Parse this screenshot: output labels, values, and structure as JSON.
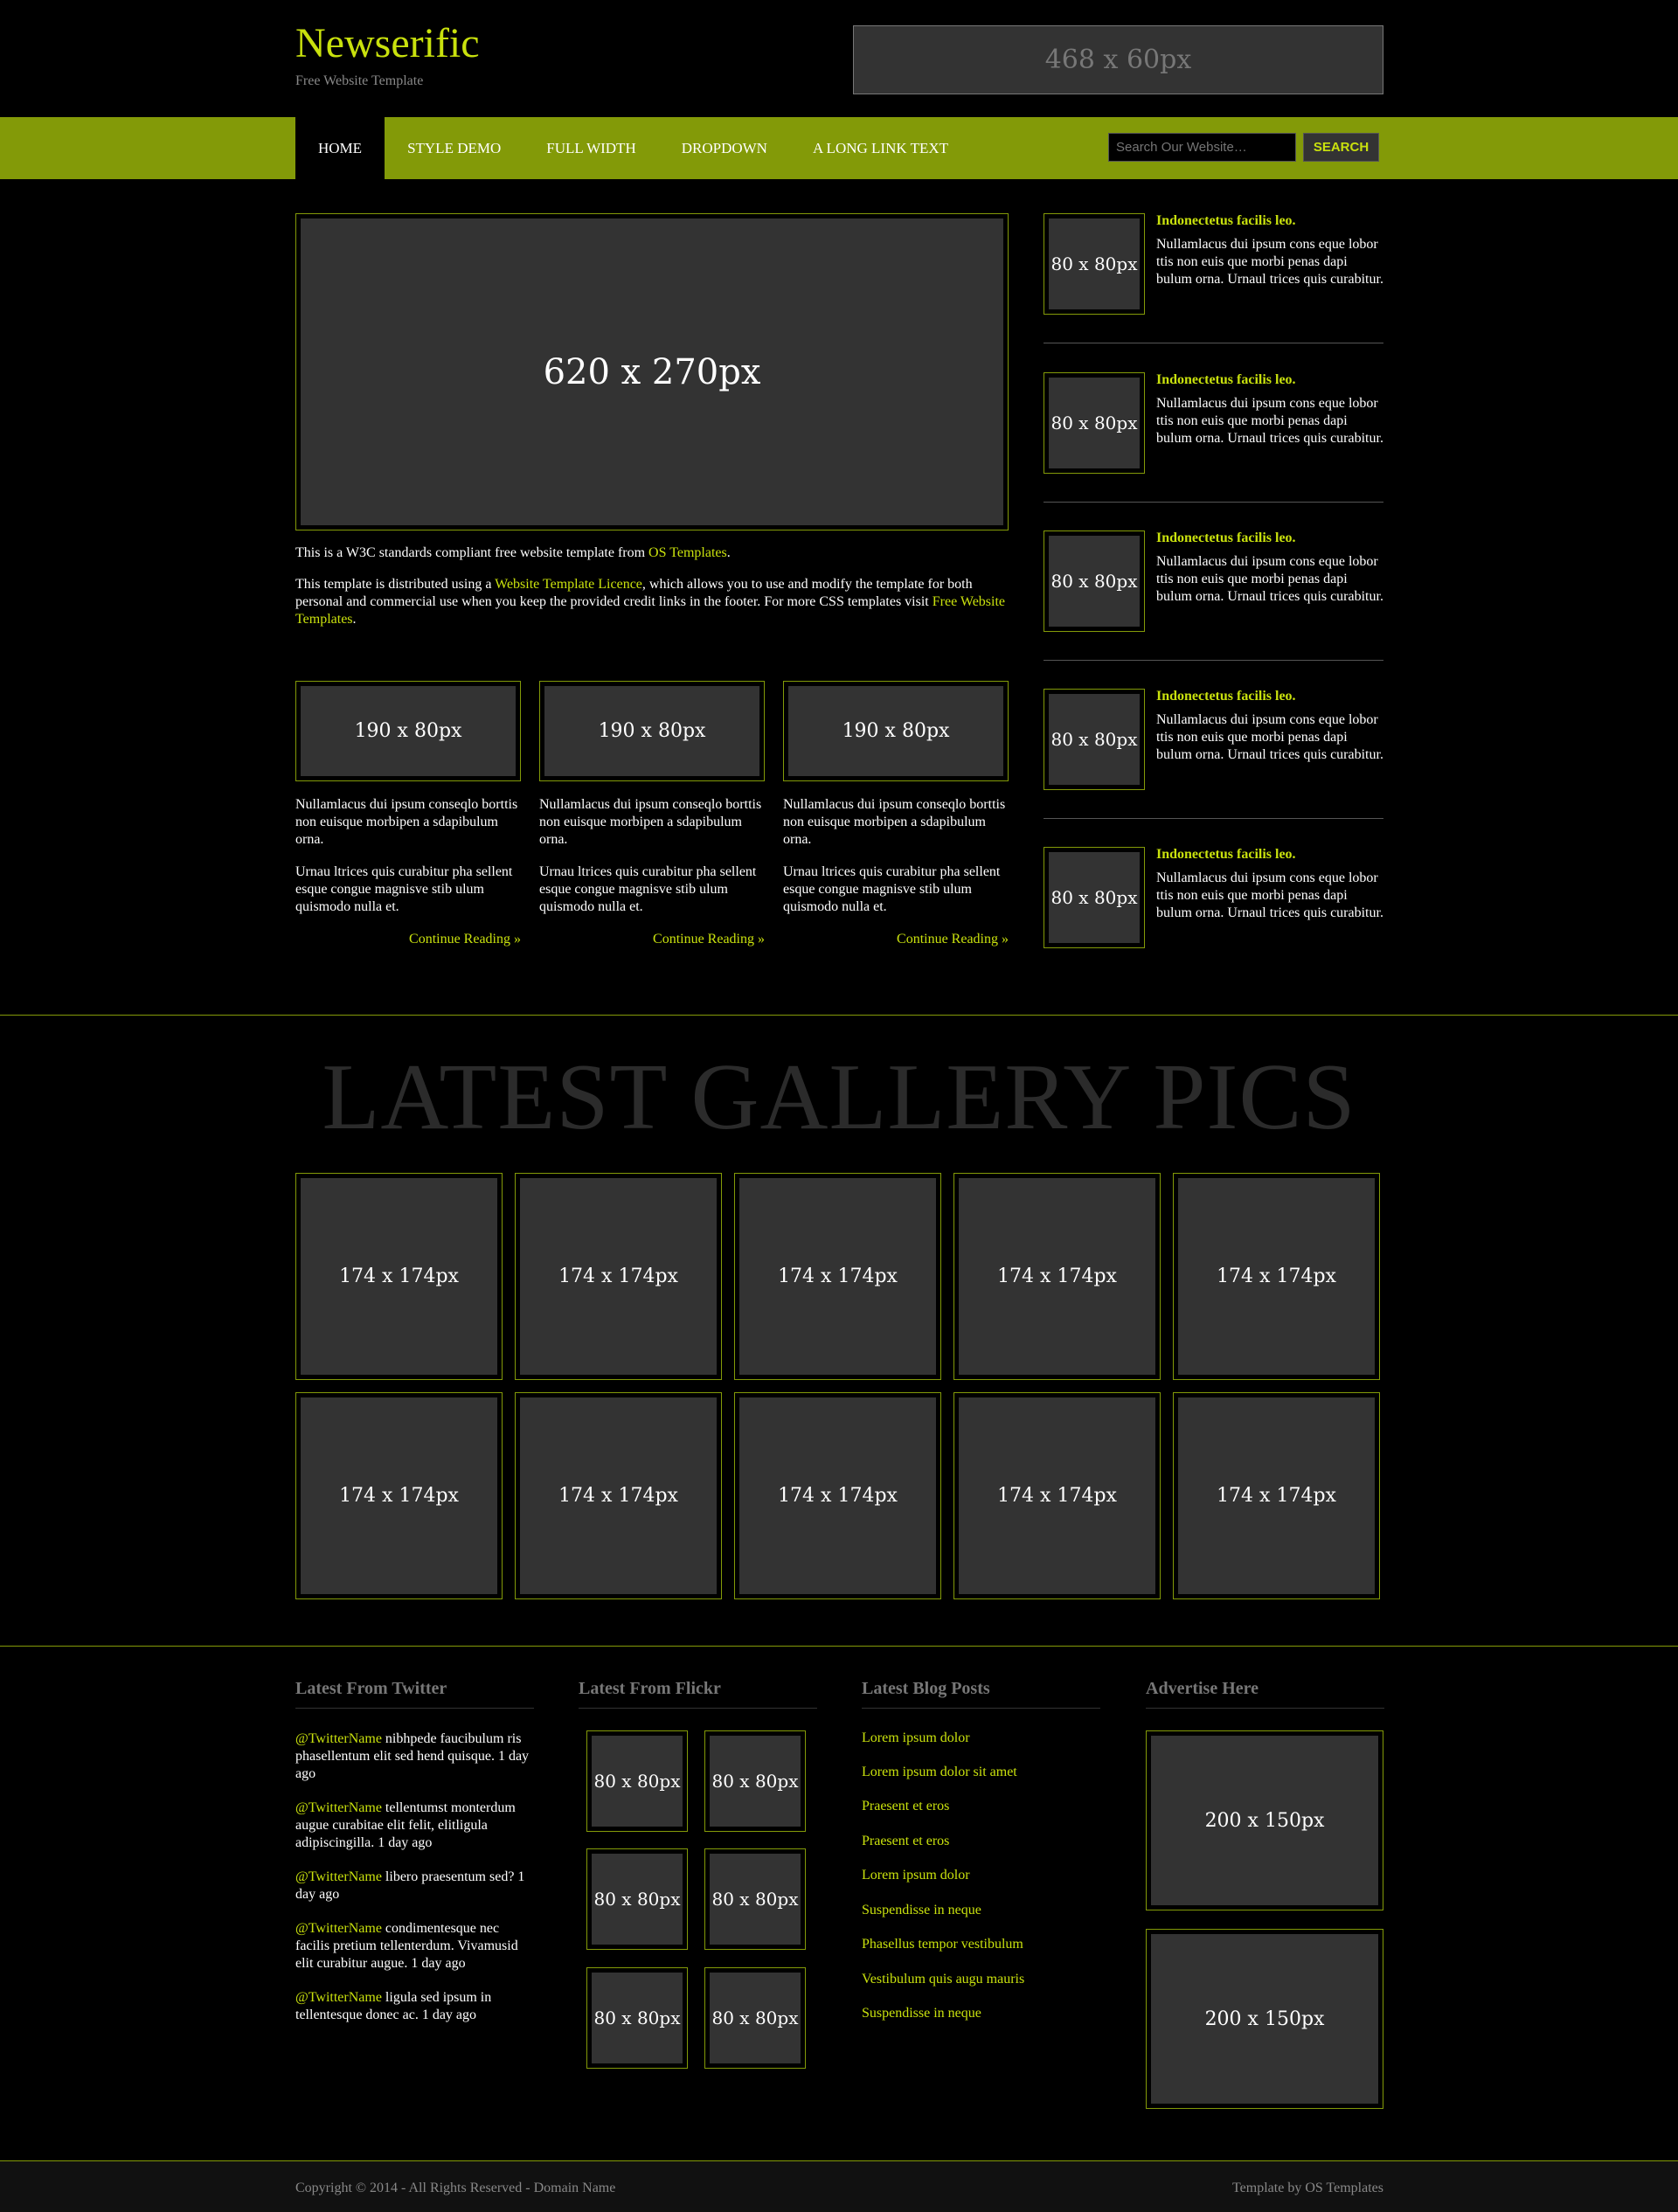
{
  "header": {
    "logo": "Newserific",
    "tagline": "Free Website Template",
    "banner_label": "468 x 60px"
  },
  "nav": {
    "items": [
      "Home",
      "Style Demo",
      "Full Width",
      "Dropdown",
      "A Long Link Text"
    ],
    "active_index": 0,
    "search_placeholder": "Search Our Website…",
    "search_button": "Search"
  },
  "main": {
    "hero_label": "620 x 270px",
    "intro_prefix": "This is a W3C standards compliant free website template from ",
    "intro_link": "OS Templates",
    "intro_suffix": ".",
    "licence_1": "This template is distributed using a ",
    "licence_link": "Website Template Licence",
    "licence_2": ", which allows you to use and modify the template for both personal and commercial use when you keep the provided credit links in the footer. For more CSS templates visit ",
    "licence_link2": "Free Website Templates",
    "licence_3": ".",
    "columns": [
      {
        "image_label": "190 x 80px",
        "para1": "Nullamlacus dui ipsum conseqlo borttis non euisque morbipen a sdapibulum orna.",
        "para2": "Urnau ltrices quis curabitur pha sellent esque congue magnisve stib ulum quismodo nulla et.",
        "more": "Continue Reading »"
      },
      {
        "image_label": "190 x 80px",
        "para1": "Nullamlacus dui ipsum conseqlo borttis non euisque morbipen a sdapibulum orna.",
        "para2": "Urnau ltrices quis curabitur pha sellent esque congue magnisve stib ulum quismodo nulla et.",
        "more": "Continue Reading »"
      },
      {
        "image_label": "190 x 80px",
        "para1": "Nullamlacus dui ipsum conseqlo borttis non euisque morbipen a sdapibulum orna.",
        "para2": "Urnau ltrices quis curabitur pha sellent esque congue magnisve stib ulum quismodo nulla et.",
        "more": "Continue Reading »"
      }
    ]
  },
  "sidebar": {
    "items": [
      {
        "image_label": "80 x 80px",
        "title": "Indonectetus facilis leo.",
        "text": "Nullamlacus dui ipsum cons eque lobor ttis non euis que morbi penas dapi bulum orna. Urnaul trices quis curabitur."
      },
      {
        "image_label": "80 x 80px",
        "title": "Indonectetus facilis leo.",
        "text": "Nullamlacus dui ipsum cons eque lobor ttis non euis que morbi penas dapi bulum orna. Urnaul trices quis curabitur."
      },
      {
        "image_label": "80 x 80px",
        "title": "Indonectetus facilis leo.",
        "text": "Nullamlacus dui ipsum cons eque lobor ttis non euis que morbi penas dapi bulum orna. Urnaul trices quis curabitur."
      },
      {
        "image_label": "80 x 80px",
        "title": "Indonectetus facilis leo.",
        "text": "Nullamlacus dui ipsum cons eque lobor ttis non euis que morbi penas dapi bulum orna. Urnaul trices quis curabitur."
      },
      {
        "image_label": "80 x 80px",
        "title": "Indonectetus facilis leo.",
        "text": "Nullamlacus dui ipsum cons eque lobor ttis non euis que morbi penas dapi bulum orna. Urnaul trices quis curabitur."
      }
    ]
  },
  "gallery": {
    "heading": "LATEST GALLERY PICS",
    "items": [
      "174 x 174px",
      "174 x 174px",
      "174 x 174px",
      "174 x 174px",
      "174 x 174px",
      "174 x 174px",
      "174 x 174px",
      "174 x 174px",
      "174 x 174px",
      "174 x 174px"
    ]
  },
  "footer": {
    "twitter": {
      "title": "Latest From Twitter",
      "tweets": [
        {
          "handle": "@TwitterName",
          "text": " nibhpede faucibulum ris phasellentum elit sed hend quisque. 1 day ago"
        },
        {
          "handle": "@TwitterName",
          "text": " tellentumst monterdum augue curabitae elit felit, elitligula adipiscingilla. 1 day ago"
        },
        {
          "handle": "@TwitterName",
          "text": " libero praesentum sed? 1 day ago"
        },
        {
          "handle": "@TwitterName",
          "text": " condimentesque nec facilis pretium tellenterdum. Vivamusid elit curabitur augue. 1 day ago"
        },
        {
          "handle": "@TwitterName",
          "text": " ligula sed ipsum in tellentesque donec ac. 1 day ago"
        }
      ]
    },
    "flickr": {
      "title": "Latest From Flickr",
      "items": [
        "80 x 80px",
        "80 x 80px",
        "80 x 80px",
        "80 x 80px",
        "80 x 80px",
        "80 x 80px"
      ]
    },
    "blog": {
      "title": "Latest Blog Posts",
      "links": [
        "Lorem ipsum dolor",
        "Lorem ipsum dolor sit amet",
        "Praesent et eros",
        "Praesent et eros",
        "Lorem ipsum dolor",
        "Suspendisse in neque",
        "Phasellus tempor vestibulum",
        "Vestibulum quis augu mauris",
        "Suspendisse in neque"
      ]
    },
    "advertise": {
      "title": "Advertise Here",
      "items": [
        "200 x 150px",
        "200 x 150px"
      ]
    }
  },
  "bottom": {
    "copyright": "Copyright © 2014 - All Rights Reserved - Domain Name",
    "credit": "Template by OS Templates"
  },
  "colors": {
    "accent": "#c9e10d",
    "nav_bg": "#839a08",
    "placeholder_bg": "#333333"
  }
}
